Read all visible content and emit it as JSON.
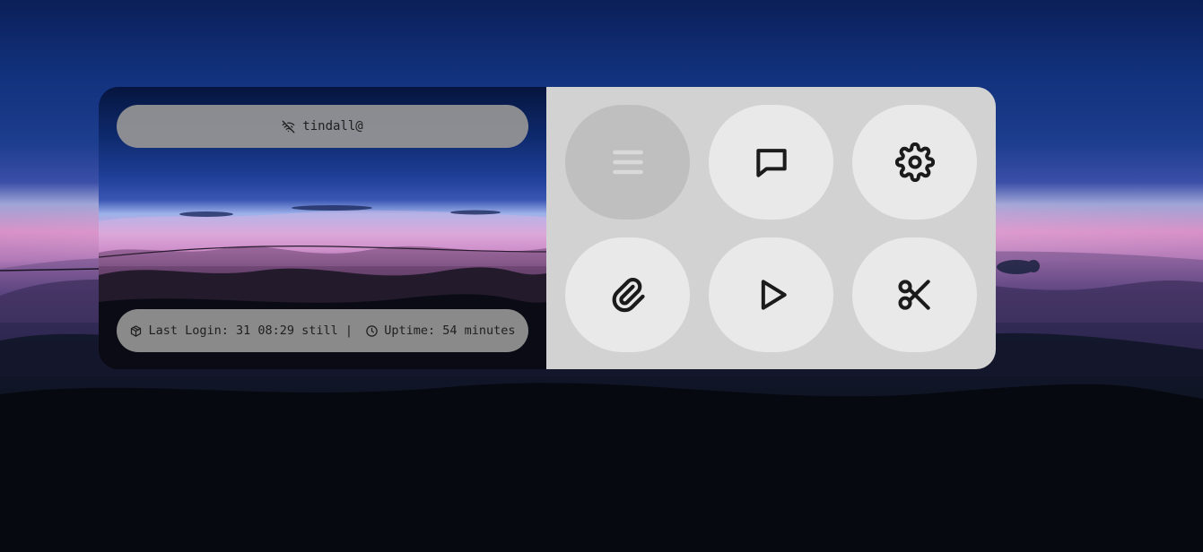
{
  "wallpaper": {
    "description_colors": {
      "sky_top": "#0b1f58",
      "horizon_pink": "#d790c7",
      "ground": "#030409"
    }
  },
  "panel": {
    "user": {
      "icon": "wifi-off-icon",
      "name": "tindall@"
    },
    "status": {
      "login_icon": "package-icon",
      "last_login": "Last Login: 31 08:29 still | ",
      "uptime_icon": "clock-icon",
      "uptime": "Uptime: 54 minutes"
    },
    "actions": [
      {
        "id": "menu",
        "icon": "menu-icon",
        "active": true
      },
      {
        "id": "chat",
        "icon": "message-square-icon",
        "active": false
      },
      {
        "id": "settings",
        "icon": "gear-icon",
        "active": false
      },
      {
        "id": "attach",
        "icon": "paperclip-icon",
        "active": false
      },
      {
        "id": "play",
        "icon": "play-icon",
        "active": false
      },
      {
        "id": "cut",
        "icon": "scissors-icon",
        "active": false
      }
    ],
    "colors": {
      "pill_bg": "#969696",
      "right_bg": "#d2d2d2",
      "tile_bg": "#e9e9e9",
      "tile_active_bg": "#bfbfbf",
      "icon": "#1b1b1b"
    }
  }
}
